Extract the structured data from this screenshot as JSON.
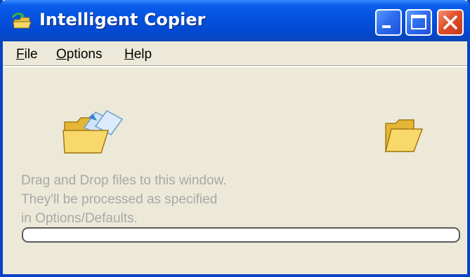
{
  "window": {
    "title": "Intelligent Copier",
    "title_bg": "#0553E0",
    "app_icon": "copy-folder-icon"
  },
  "controls": {
    "minimize_icon": "minimize-icon",
    "maximize_icon": "maximize-icon",
    "close_icon": "close-icon"
  },
  "menu": {
    "items": [
      {
        "underline": "F",
        "rest": "ile"
      },
      {
        "underline": "O",
        "rest": "ptions"
      },
      {
        "underline": "H",
        "rest": "elp"
      }
    ]
  },
  "main": {
    "source_icon": "folder-with-documents-icon",
    "target_icon": "folder-icon",
    "hint_lines": [
      "Drag and Drop files to this window.",
      "They'll be processed as specified",
      "in Options/Defaults."
    ],
    "progress": 0
  }
}
